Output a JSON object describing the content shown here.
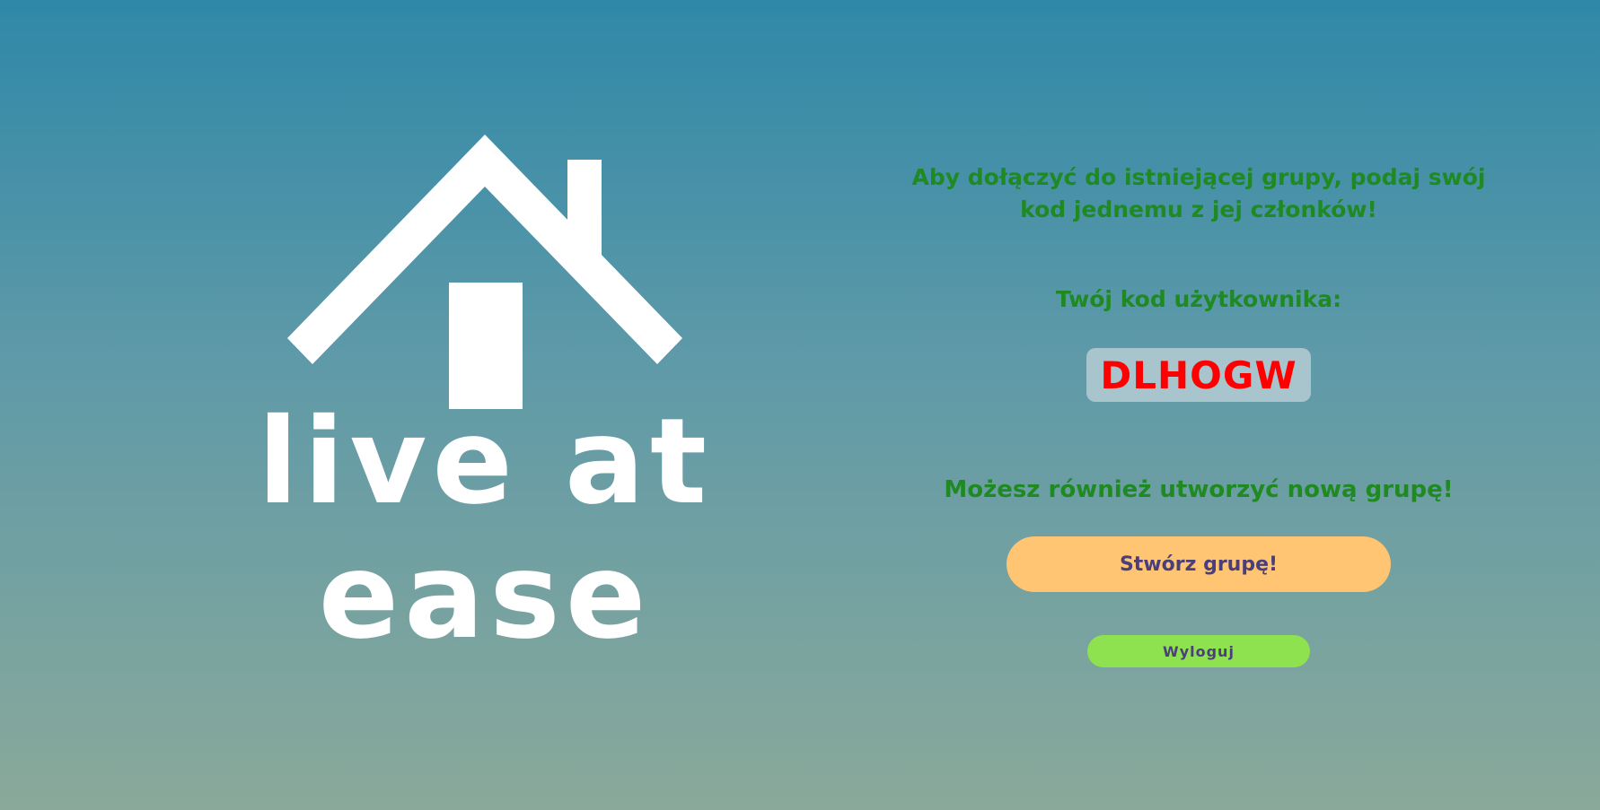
{
  "logo": {
    "line1": "live at",
    "line2": "ease"
  },
  "panel": {
    "join_message": "Aby dołączyć do istniejącej grupy, podaj swój kod jednemu z jej członków!",
    "code_label": "Twój kod użytkownika:",
    "user_code": "DLHOGW",
    "create_message": "Możesz również utworzyć nową grupę!",
    "create_button_label": "Stwórz grupę!",
    "logout_button_label": "Wyloguj"
  },
  "colors": {
    "message_text": "#1f8a21",
    "code_text": "#ff0000",
    "code_box": "#a8c4cc",
    "create_button": "#ffc573",
    "logout_button": "#8ee250",
    "button_text": "#4a3f7a"
  }
}
